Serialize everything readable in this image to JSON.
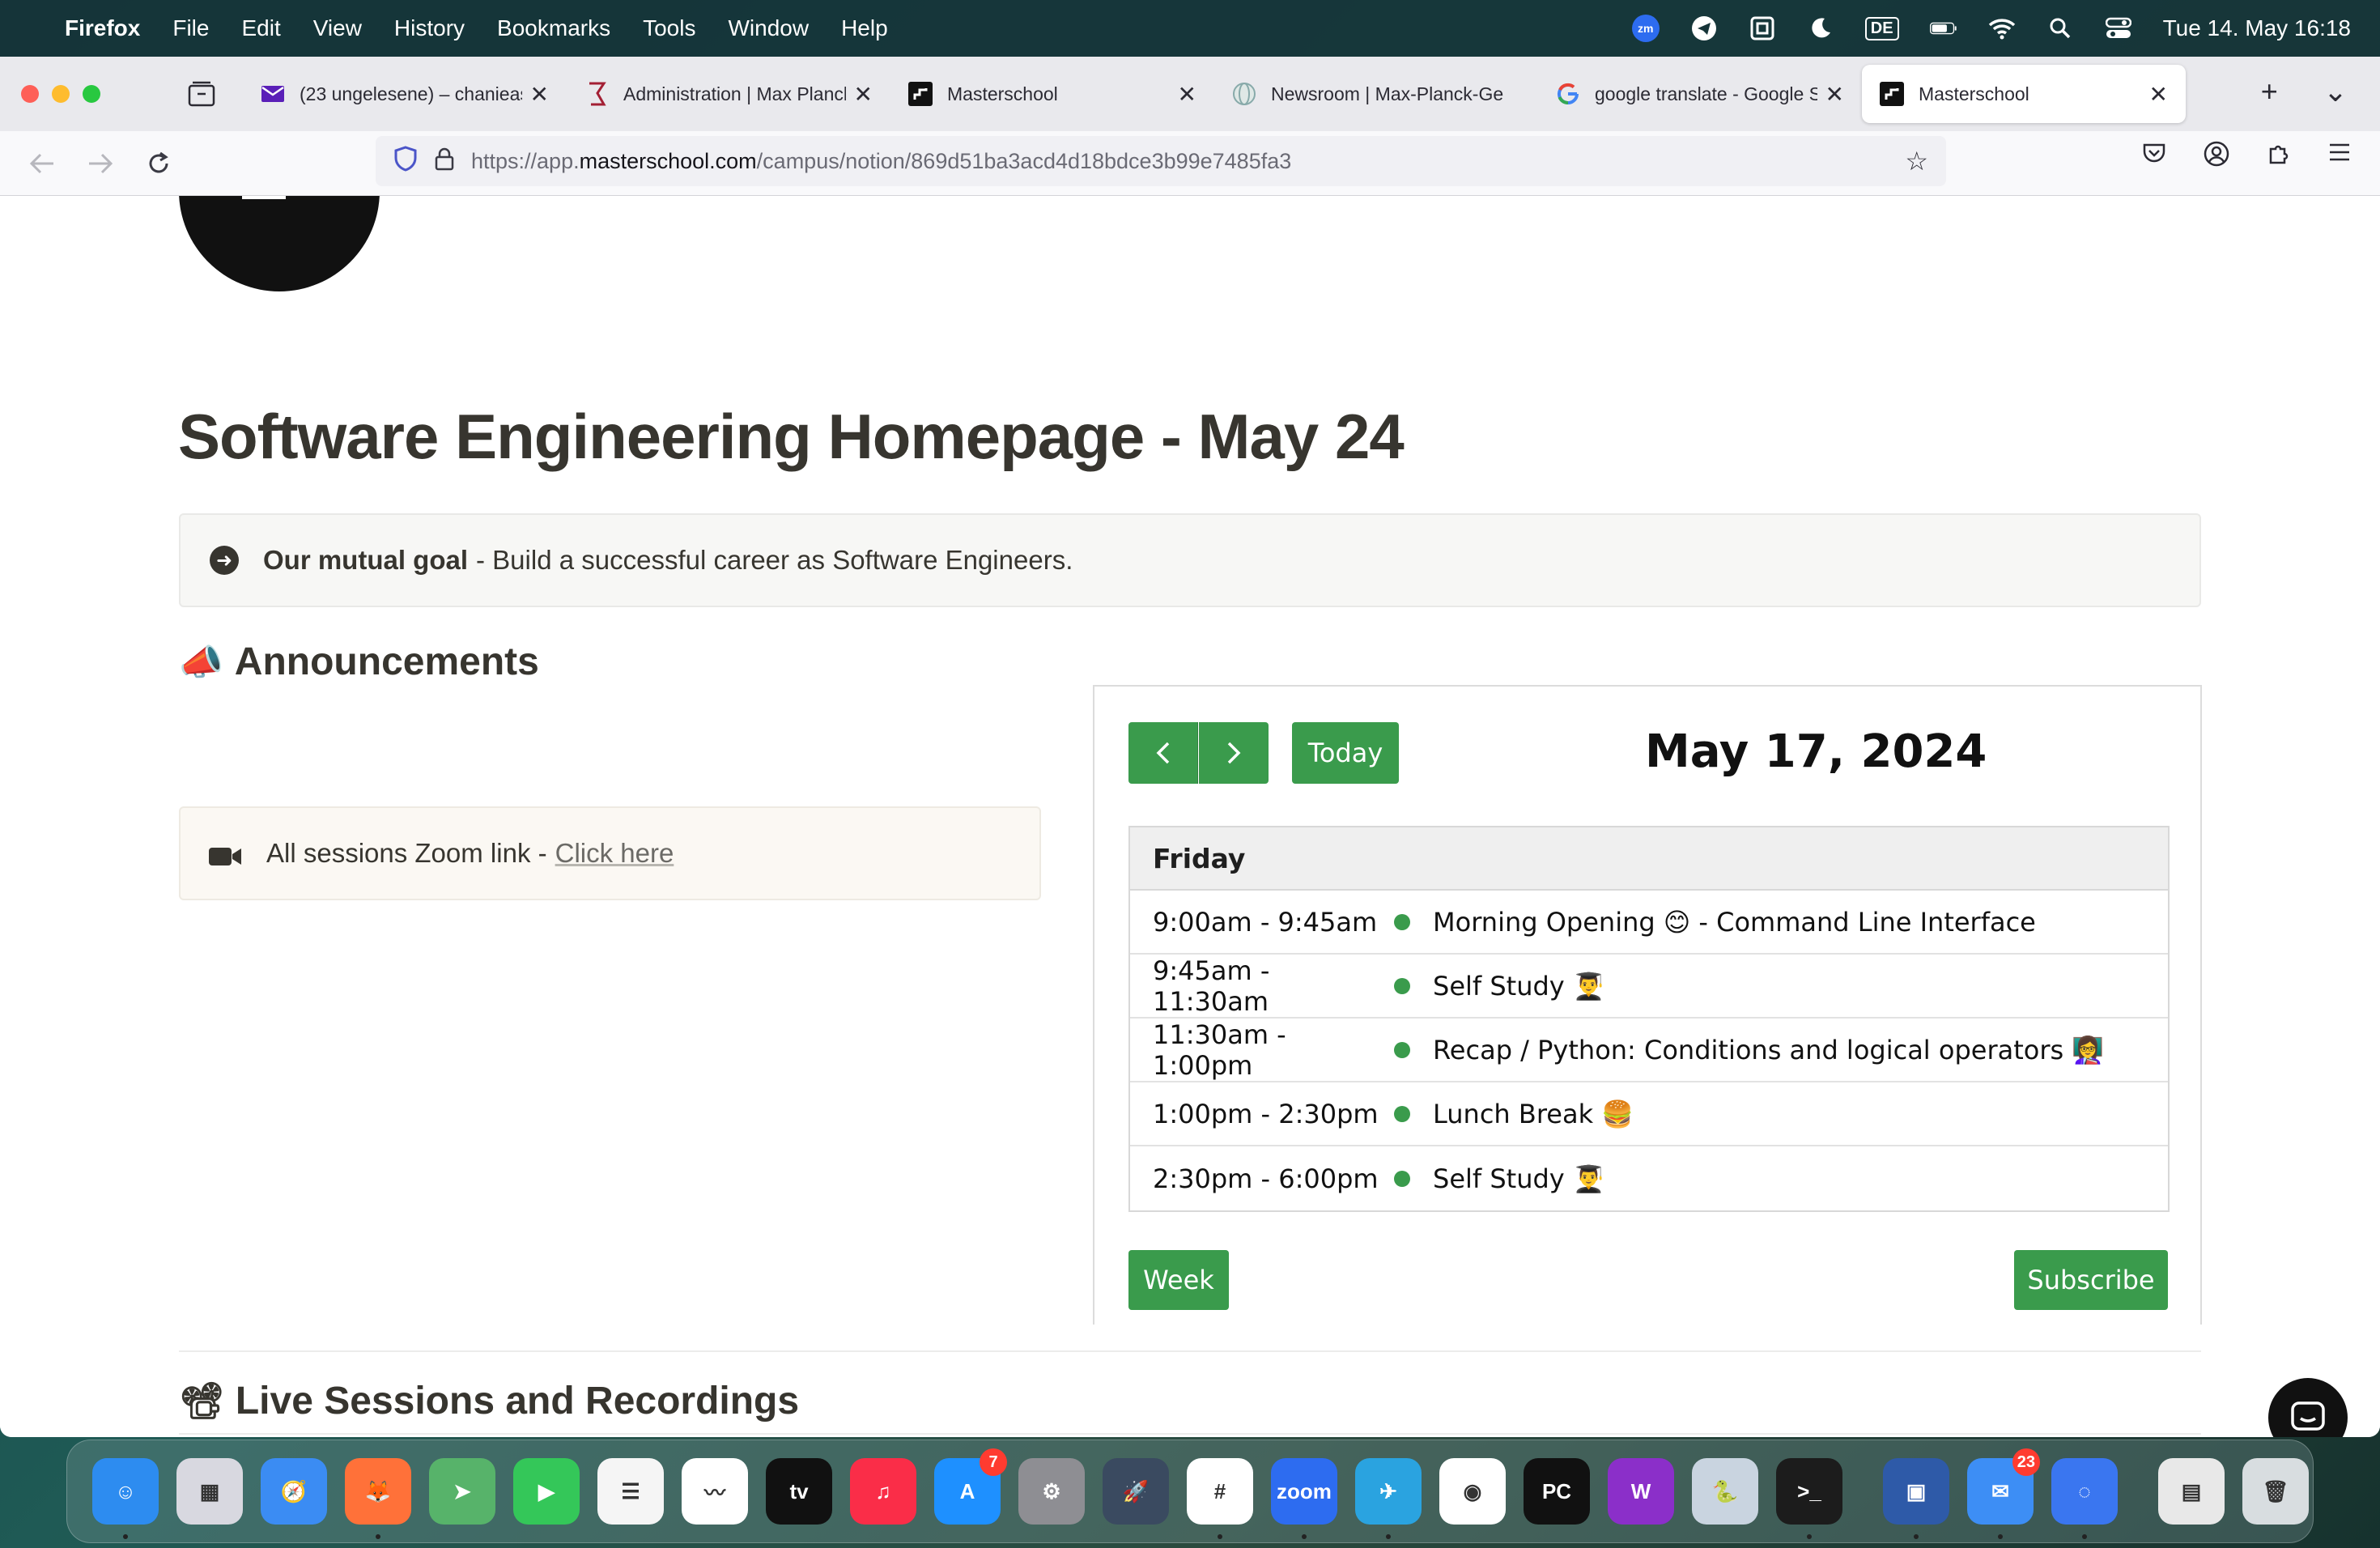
{
  "menubar": {
    "app": "Firefox",
    "items": [
      "File",
      "Edit",
      "View",
      "History",
      "Bookmarks",
      "Tools",
      "Window",
      "Help"
    ],
    "input_source": "DE",
    "zoom_badge": "zm",
    "datetime": "Tue 14. May  16:18"
  },
  "tabs": [
    {
      "title": "(23 ungelesene) – chanieas",
      "icon": "mail-icon"
    },
    {
      "title": "Administration | Max Planck",
      "icon": "mpg-icon"
    },
    {
      "title": "Masterschool",
      "icon": "masterschool-icon"
    },
    {
      "title": "Newsroom | Max-Planck-Ge",
      "icon": "globe-icon"
    },
    {
      "title": "google translate - Google S",
      "icon": "google-icon"
    },
    {
      "title": "Masterschool",
      "icon": "masterschool-icon",
      "active": true
    }
  ],
  "url": {
    "scheme": "https://app.",
    "host": "masterschool.com",
    "path": "/campus/notion/869d51ba3acd4d18bdce3b99e7485fa3"
  },
  "page": {
    "title": "Software Engineering Homepage - May 24",
    "callout": {
      "bold": "Our mutual goal",
      "text": "- Build a successful career as Software Engineers."
    },
    "announcements": {
      "emoji": "📣",
      "heading": "Announcements"
    },
    "zoom": {
      "text": "All sessions Zoom link -",
      "link": "Click here"
    },
    "live": {
      "emoji": "📽",
      "heading": "Live Sessions and Recordings"
    }
  },
  "calendar": {
    "today_label": "Today",
    "date": "May 17, 2024",
    "day": "Friday",
    "events": [
      {
        "time": "9:00am - 9:45am",
        "title": "Morning Opening 😊 - Command Line Interface"
      },
      {
        "time": "9:45am - 11:30am",
        "title": "Self Study 👨‍🎓"
      },
      {
        "time": "11:30am - 1:00pm",
        "title": "Recap / Python: Conditions and logical operators 👩‍🏫"
      },
      {
        "time": "1:00pm - 2:30pm",
        "title": "Lunch Break 🍔"
      },
      {
        "time": "2:30pm - 6:00pm",
        "title": "Self Study 👨‍🎓"
      }
    ],
    "week_label": "Week",
    "subscribe_label": "Subscribe",
    "accent": "#3a9b4c"
  },
  "dock": {
    "apps": [
      {
        "name": "Finder",
        "color": "#2d8cf0",
        "label": "☺"
      },
      {
        "name": "Launchpad",
        "color": "#d8d8e0",
        "label": "▦"
      },
      {
        "name": "Safari",
        "color": "#3b8cf3",
        "label": "🧭"
      },
      {
        "name": "Firefox",
        "color": "#ff7139",
        "label": "🦊"
      },
      {
        "name": "Maps",
        "color": "#57b36a",
        "label": "➤"
      },
      {
        "name": "FaceTime",
        "color": "#34c759",
        "label": "▶"
      },
      {
        "name": "Reminders",
        "color": "#f5f5f5",
        "label": "☰"
      },
      {
        "name": "Freeform",
        "color": "#ffffff",
        "label": "〰"
      },
      {
        "name": "TV",
        "color": "#111111",
        "label": "tv"
      },
      {
        "name": "Music",
        "color": "#fa2d48",
        "label": "♫"
      },
      {
        "name": "App Store",
        "color": "#1e90ff",
        "label": "A",
        "badge": "7"
      },
      {
        "name": "System Settings",
        "color": "#8e8e93",
        "label": "⚙"
      },
      {
        "name": "Rocket",
        "color": "#3a4a60",
        "label": "🚀"
      },
      {
        "name": "Slack",
        "color": "#ffffff",
        "label": "#"
      },
      {
        "name": "Zoom",
        "color": "#2d6cf0",
        "label": "zoom"
      },
      {
        "name": "Telegram",
        "color": "#2aa3e0",
        "label": "✈"
      },
      {
        "name": "Chrome",
        "color": "#ffffff",
        "label": "◉"
      },
      {
        "name": "PyCharm",
        "color": "#111111",
        "label": "PC"
      },
      {
        "name": "Wondershare",
        "color": "#8b2fc9",
        "label": "W"
      },
      {
        "name": "Python Launcher",
        "color": "#c9d4e0",
        "label": "🐍"
      },
      {
        "name": "Terminal",
        "color": "#1c1c1c",
        "label": ">_"
      },
      {
        "name": "Proxy",
        "color": "#2e5aa8",
        "label": "▣"
      },
      {
        "name": "Mail",
        "color": "#3d8ef5",
        "label": "✉",
        "badge": "23"
      },
      {
        "name": "Signal",
        "color": "#3a76f0",
        "label": "◌"
      },
      {
        "name": "Document",
        "color": "#e8e8e8",
        "label": "▤"
      },
      {
        "name": "Trash",
        "color": "#d8dde0",
        "label": "🗑"
      }
    ]
  }
}
